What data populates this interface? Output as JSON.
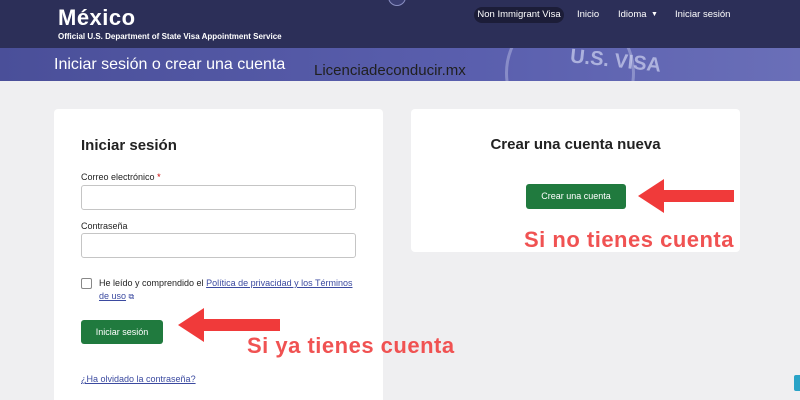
{
  "header": {
    "title": "México",
    "subtitle": "Official U.S. Department of State Visa Appointment Service",
    "nav": {
      "visa_type": "Non Immigrant Visa",
      "home": "Inicio",
      "language": "Idioma",
      "login": "Iniciar sesión"
    }
  },
  "banner": {
    "title": "Iniciar sesión o crear una cuenta",
    "seal_text": "U.S. VISA"
  },
  "watermark": "Licenciadeconducir.mx",
  "login": {
    "heading": "Iniciar sesión",
    "email_label": "Correo electrónico",
    "required_mark": "*",
    "email_value": "",
    "password_label": "Contraseña",
    "password_value": "",
    "consent_text": "He leído y comprendido el",
    "consent_link": "Política de privacidad y los Términos de uso",
    "submit_label": "Iniciar sesión",
    "forgot_link": "¿Ha olvidado la contraseña?"
  },
  "create": {
    "heading": "Crear una cuenta nueva",
    "button_label": "Crear una cuenta"
  },
  "annotations": {
    "has_account": "Si ya tienes cuenta",
    "no_account": "Si no tienes cuenta",
    "color": "#f05252"
  },
  "colors": {
    "header_bg": "#2c2f58",
    "banner_bg": "#5a5fae",
    "button_green": "#207a3e",
    "link": "#3b4aa0"
  }
}
